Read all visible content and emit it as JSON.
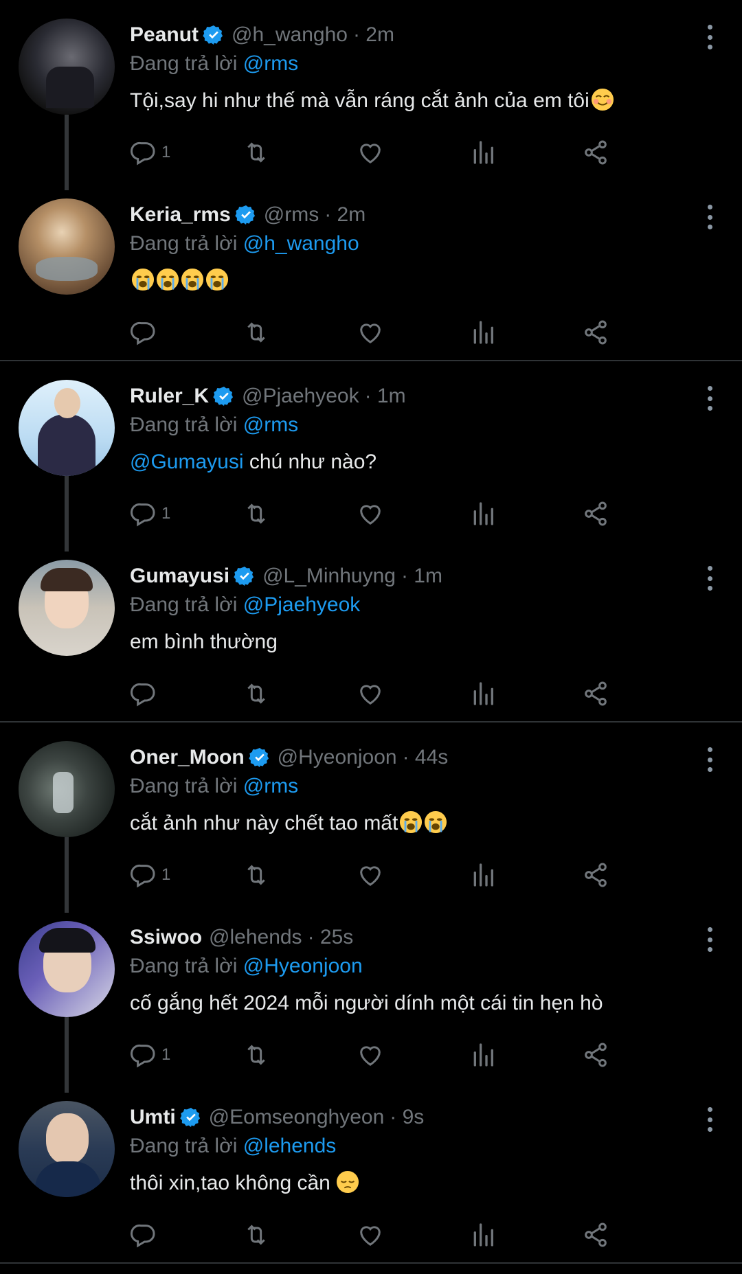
{
  "colors": {
    "background": "#000000",
    "text": "#e7e9ea",
    "muted": "#71767b",
    "link": "#1d9bf0",
    "verified": "#1d9bf0",
    "divider": "#2f3336"
  },
  "icons": [
    "verified-badge-icon",
    "more-options-icon",
    "reply-icon",
    "retweet-icon",
    "like-icon",
    "views-icon",
    "share-icon",
    "crying-face-emoji",
    "smiling-face-emoji",
    "pensive-face-emoji"
  ],
  "tweets": [
    {
      "name": "Peanut",
      "handle": "@h_wangho",
      "time": "· 2m",
      "reply_prefix": "Đang trả lời ",
      "reply_to": "@rms",
      "text": "Tội,say hi như thế mà vẫn ráng cắt ảnh của em tôi",
      "reply_count": "1",
      "verified": true
    },
    {
      "name": "Keria_rms",
      "handle": "@rms",
      "time": "· 2m",
      "reply_prefix": "Đang trả lời ",
      "reply_to": "@h_wangho",
      "text": "",
      "reply_count": "",
      "verified": true
    },
    {
      "name": "Ruler_K",
      "handle": "@Pjaehyeok",
      "time": "· 1m",
      "reply_prefix": "Đang trả lời ",
      "reply_to": "@rms",
      "mention": "@Gumayusi",
      "text": " chú như nào?",
      "reply_count": "1",
      "verified": true
    },
    {
      "name": "Gumayusi",
      "handle": "@L_Minhuyng",
      "time": "· 1m",
      "reply_prefix": "Đang trả lời ",
      "reply_to": "@Pjaehyeok",
      "text": "em bình thường",
      "reply_count": "",
      "verified": true
    },
    {
      "name": "Oner_Moon",
      "handle": "@Hyeonjoon",
      "time": "· 44s",
      "reply_prefix": "Đang trả lời ",
      "reply_to": "@rms",
      "text": "cắt ảnh như này chết tao mất",
      "reply_count": "1",
      "verified": true
    },
    {
      "name": "Ssiwoo",
      "handle": "@lehends",
      "time": "· 25s",
      "reply_prefix": "Đang trả lời ",
      "reply_to": "@Hyeonjoon",
      "text": "cố gắng hết 2024 mỗi người dính một cái tin hẹn hò",
      "reply_count": "1",
      "verified": false
    },
    {
      "name": "Umti",
      "handle": "@Eomseonghyeon",
      "time": "· 9s",
      "reply_prefix": "Đang trả lời ",
      "reply_to": "@lehends",
      "text": "thôi xin,tao không cần",
      "reply_count": "",
      "verified": true
    }
  ]
}
